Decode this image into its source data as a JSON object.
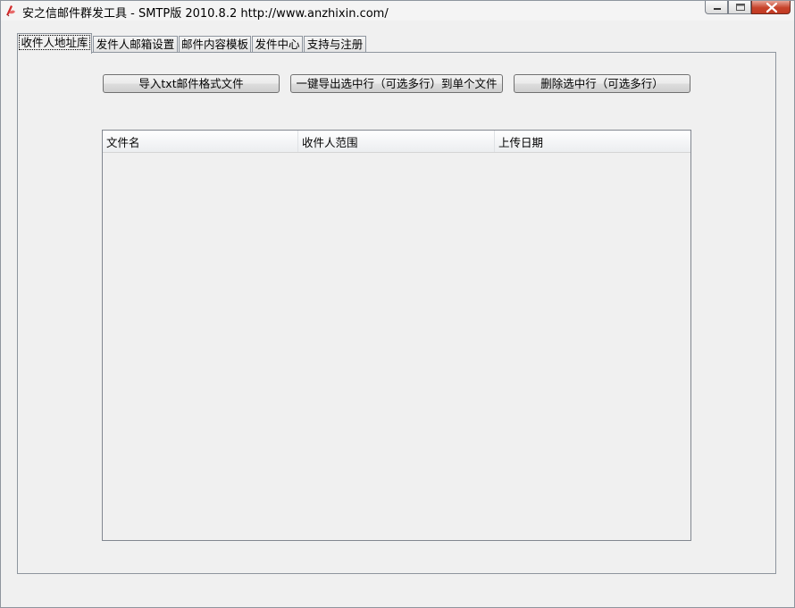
{
  "window": {
    "title": "安之信邮件群发工具 - SMTP版 2010.8.2  http://www.anzhixin.com/"
  },
  "tabs": [
    {
      "label": "收件人地址库",
      "active": true
    },
    {
      "label": "发件人邮箱设置",
      "active": false
    },
    {
      "label": "邮件内容模板",
      "active": false
    },
    {
      "label": "发件中心",
      "active": false
    },
    {
      "label": "支持与注册",
      "active": false
    }
  ],
  "toolbar": {
    "import_label": "导入txt邮件格式文件",
    "export_label": "一键导出选中行（可选多行）到单个文件",
    "delete_label": "删除选中行（可选多行）"
  },
  "list": {
    "columns": [
      "文件名",
      "收件人范围",
      "上传日期"
    ],
    "rows": []
  },
  "colors": {
    "close_button": "#c7432b",
    "border": "#8e959e"
  },
  "icons": [
    "app-icon",
    "minimize-icon",
    "maximize-icon",
    "close-icon"
  ]
}
